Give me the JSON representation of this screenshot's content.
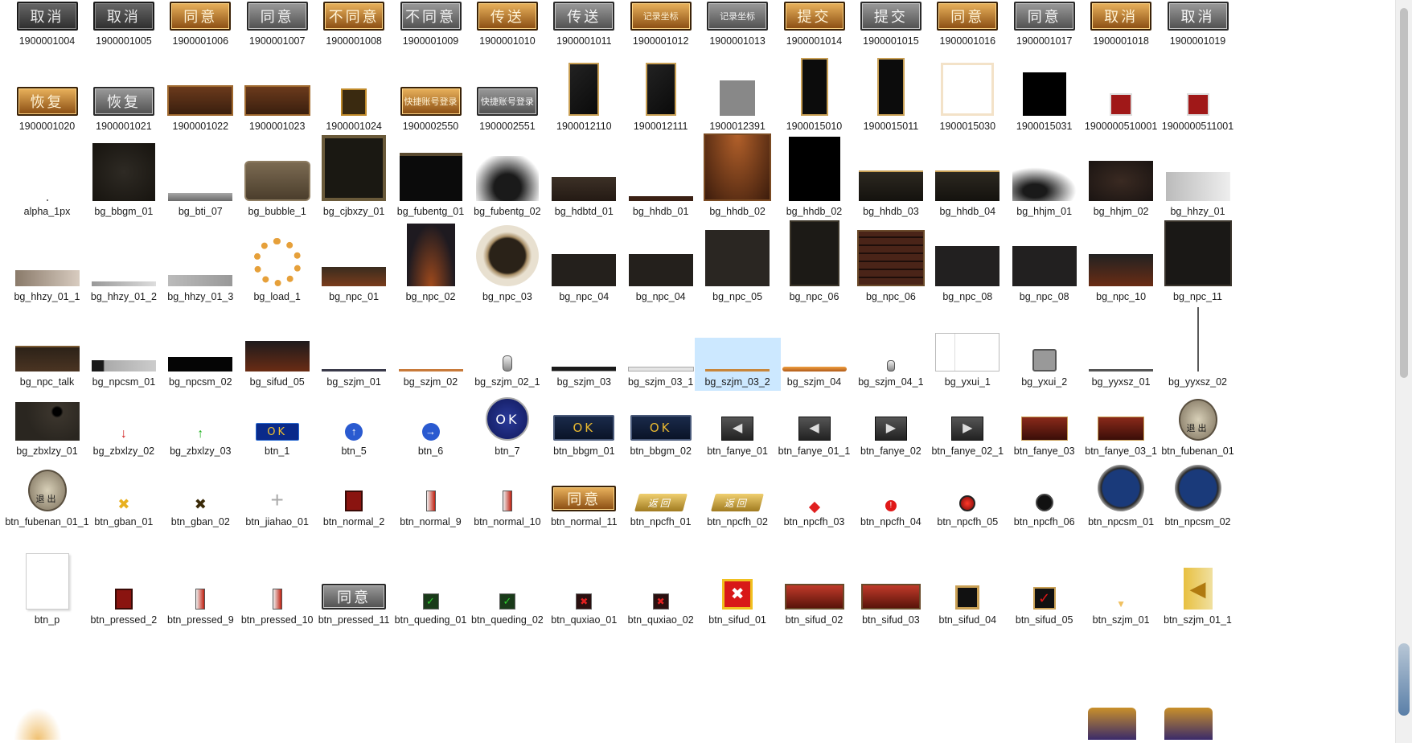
{
  "rows": [
    [
      "1900001004",
      "1900001005",
      "1900001006",
      "1900001007",
      "1900001008",
      "1900001009",
      "1900001010",
      "1900001011",
      "1900001012",
      "1900001013",
      "1900001014",
      "1900001015",
      "1900001016",
      "1900001017",
      "1900001018",
      "1900001019"
    ],
    [
      "1900001020",
      "1900001021",
      "1900001022",
      "1900001023",
      "1900001024",
      "1900002550",
      "1900002551",
      "1900012110",
      "1900012111",
      "1900012391",
      "1900015010",
      "1900015011",
      "1900015030",
      "1900015031",
      "1900000510001",
      "1900000511001"
    ],
    [
      "alpha_1px",
      "bg_bbgm_01",
      "bg_bti_07",
      "bg_bubble_1",
      "bg_cjbxzy_01",
      "bg_fubentg_01",
      "bg_fubentg_02",
      "bg_hdbtd_01",
      "bg_hhdb_01",
      "bg_hhdb_02",
      "bg_hhdb_02",
      "bg_hhdb_03",
      "bg_hhdb_04",
      "bg_hhjm_01",
      "bg_hhjm_02",
      "bg_hhzy_01"
    ],
    [
      "bg_hhzy_01_1",
      "bg_hhzy_01_2",
      "bg_hhzy_01_3",
      "bg_load_1",
      "bg_npc_01",
      "bg_npc_02",
      "bg_npc_03",
      "bg_npc_04",
      "bg_npc_04",
      "bg_npc_05",
      "bg_npc_06",
      "bg_npc_06",
      "bg_npc_08",
      "bg_npc_08",
      "bg_npc_10",
      "bg_npc_11"
    ],
    [
      "bg_npc_talk",
      "bg_npcsm_01",
      "bg_npcsm_02",
      "bg_sifud_05",
      "bg_szjm_01",
      "bg_szjm_02",
      "bg_szjm_02_1",
      "bg_szjm_03",
      "bg_szjm_03_1",
      "bg_szjm_03_2",
      "bg_szjm_04",
      "bg_szjm_04_1",
      "bg_yxui_1",
      "bg_yxui_2",
      "bg_yyxsz_01",
      "bg_yyxsz_02"
    ],
    [
      "bg_zbxlzy_01",
      "bg_zbxlzy_02",
      "bg_zbxlzy_03",
      "btn_1",
      "btn_5",
      "btn_6",
      "btn_7",
      "btn_bbgm_01",
      "btn_bbgm_02",
      "btn_fanye_01",
      "btn_fanye_01_1",
      "btn_fanye_02",
      "btn_fanye_02_1",
      "btn_fanye_03",
      "btn_fanye_03_1",
      "btn_fubenan_01"
    ],
    [
      "btn_fubenan_01_1",
      "btn_gban_01",
      "btn_gban_02",
      "btn_jiahao_01",
      "btn_normal_2",
      "btn_normal_9",
      "btn_normal_10",
      "btn_normal_11",
      "btn_npcfh_01",
      "btn_npcfh_02",
      "btn_npcfh_03",
      "btn_npcfh_04",
      "btn_npcfh_05",
      "btn_npcfh_06",
      "btn_npcsm_01",
      "btn_npcsm_02"
    ],
    [
      "btn_p",
      "btn_pressed_2",
      "btn_pressed_9",
      "btn_pressed_10",
      "btn_pressed_11",
      "btn_queding_01",
      "btn_queding_02",
      "btn_quxiao_01",
      "btn_quxiao_02",
      "btn_sifud_01",
      "btn_sifud_02",
      "btn_sifud_03",
      "btn_sifud_04",
      "btn_sifud_05",
      "btn_szjm_01",
      "btn_szjm_01_1"
    ]
  ],
  "selected": "bg_szjm_03_2",
  "thumb_text": {
    "1900001004": "取消",
    "1900001005": "取消",
    "1900001006": "同意",
    "1900001007": "同意",
    "1900001008": "不同意",
    "1900001009": "不同意",
    "1900001010": "传送",
    "1900001011": "传送",
    "1900001012": "记录坐标",
    "1900001013": "记录坐标",
    "1900001014": "提交",
    "1900001015": "提交",
    "1900001016": "同意",
    "1900001017": "同意",
    "1900001018": "取消",
    "1900001019": "取消",
    "1900001020": "恢复",
    "1900001021": "恢复",
    "1900002550": "快捷账号登录",
    "1900002551": "快捷账号登录",
    "btn_1": "OK",
    "btn_7": "OK",
    "btn_bbgm_01": "OK",
    "btn_bbgm_02": "OK",
    "btn_fubenan_01": "退出",
    "btn_fubenan_01_1": "退出",
    "btn_normal_11": "同意",
    "btn_pressed_11": "同意",
    "btn_npcfh_01": "返回",
    "btn_npcfh_02": "返回"
  },
  "colors": {
    "gold": "#c07a26",
    "dark": "#2a2622",
    "selection": "#cce8ff"
  }
}
